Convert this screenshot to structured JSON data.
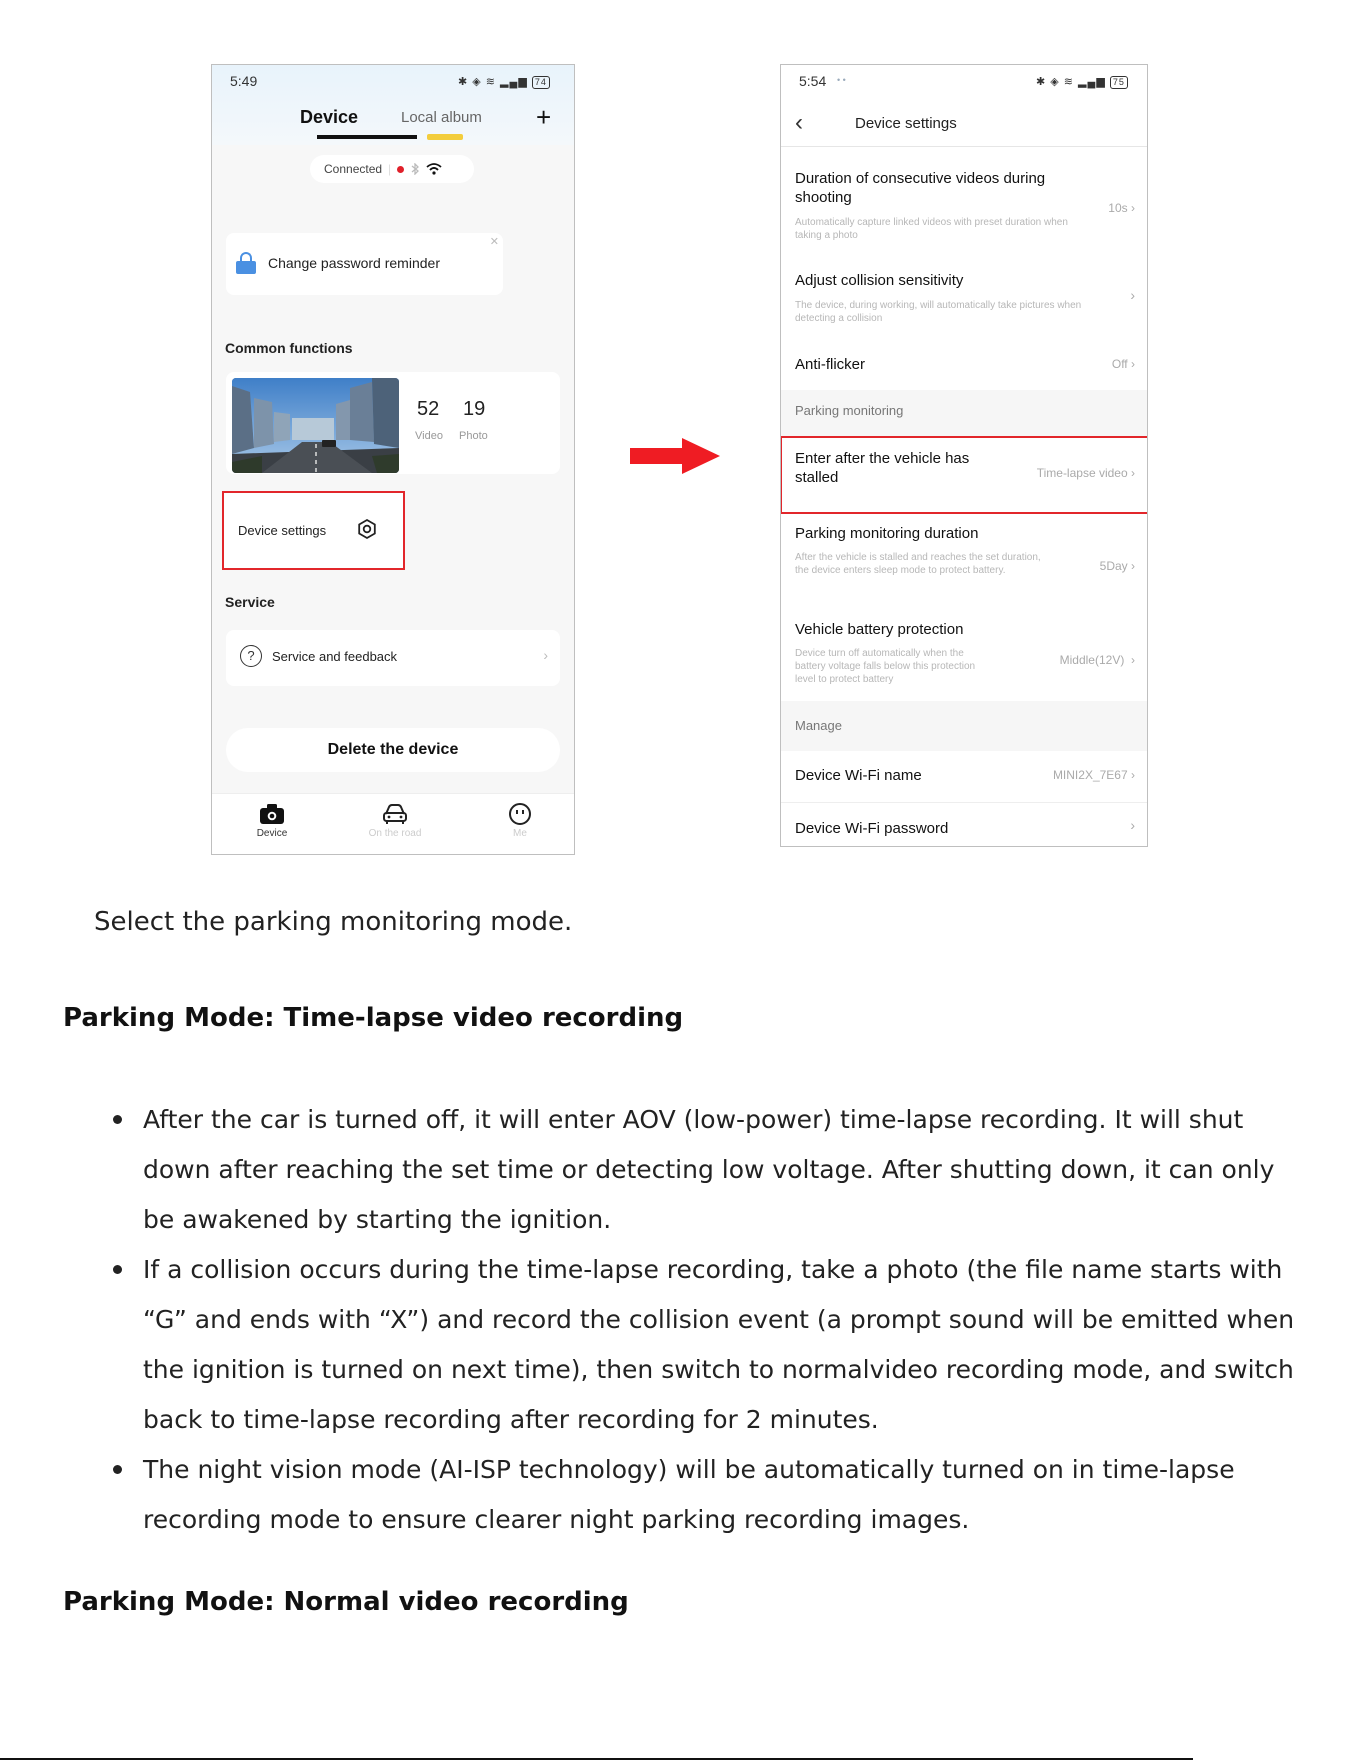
{
  "phone1": {
    "status_time": "5:49",
    "status_icons": "✱ ◈ ≋ ▂▄▆",
    "battery": "74",
    "tabs": {
      "device": "Device",
      "local_album": "Local album"
    },
    "add_symbol": "+",
    "connection_status": "Connected",
    "password_reminder": "Change password reminder",
    "common_functions_title": "Common functions",
    "video_count": "52",
    "video_label": "Video",
    "photo_count": "19",
    "photo_label": "Photo",
    "device_settings_label": "Device settings",
    "service_title": "Service",
    "service_feedback_label": "Service and feedback",
    "delete_device_label": "Delete the device",
    "nav": {
      "device": "Device",
      "on_the_road": "On the road",
      "me": "Me"
    }
  },
  "phone2": {
    "status_time": "5:54",
    "status_icons": "✱ ◈ ≋ ▂▄▆",
    "battery": "75",
    "header_title": "Device settings",
    "rows": {
      "consecutive_title": "Duration of consecutive videos during shooting",
      "consecutive_sub": "Automatically capture linked videos with preset duration when taking a photo",
      "consecutive_value": "10s",
      "collision_title": "Adjust collision sensitivity",
      "collision_sub": "The device, during working, will automatically take pictures when detecting a collision",
      "antiflicker_title": "Anti-flicker",
      "antiflicker_value": "Off",
      "parking_section": "Parking monitoring",
      "enter_title": "Enter after the vehicle has stalled",
      "enter_value": "Time-lapse video",
      "duration_title": "Parking monitoring duration",
      "duration_sub": "After the vehicle is stalled and reaches the set duration, the device enters sleep mode to protect battery.",
      "duration_value": "5Day",
      "battery_title": "Vehicle battery protection",
      "battery_sub": "Device turn off automatically when the battery voltage falls below this protection level to protect battery",
      "battery_value": "Middle(12V)",
      "manage_section": "Manage",
      "wifi_name_title": "Device Wi-Fi name",
      "wifi_name_value": "MINI2X_7E67",
      "wifi_password_title": "Device Wi-Fi password"
    },
    "chevron": "›"
  },
  "doc": {
    "caption": "Select the parking monitoring mode.",
    "heading1": "Parking Mode: Time-lapse video recording",
    "bullets": [
      "After the car is turned off, it will enter AOV (low-power) time-lapse recording. It will shut down after reaching the set time or detecting low voltage. After shutting down, it can only be awakened by starting the ignition.",
      "If a collision occurs during the time-lapse recording, take a photo (the file name starts with “G” and ends with “X”) and record the collision event (a prompt sound will be emitted when the ignition is turned on next time), then switch to normalvideo recording mode, and switch back to time-lapse recording after recording for 2 minutes.",
      "The night vision mode (AI-ISP technology) will be automatically turned on in time-lapse recording mode to ensure clearer night parking recording images."
    ],
    "heading2": "Parking Mode: Normal video recording"
  },
  "colors": {
    "highlight_red": "#e2262b",
    "accent_blue": "#4a90e2",
    "arrow_red": "#ef1c23"
  },
  "icons": {
    "lock": "lock-icon",
    "gear": "gear-icon",
    "help": "help-icon",
    "camera": "camera-icon",
    "car": "car-icon",
    "me": "face-icon",
    "arrow": "arrow-right-icon"
  }
}
